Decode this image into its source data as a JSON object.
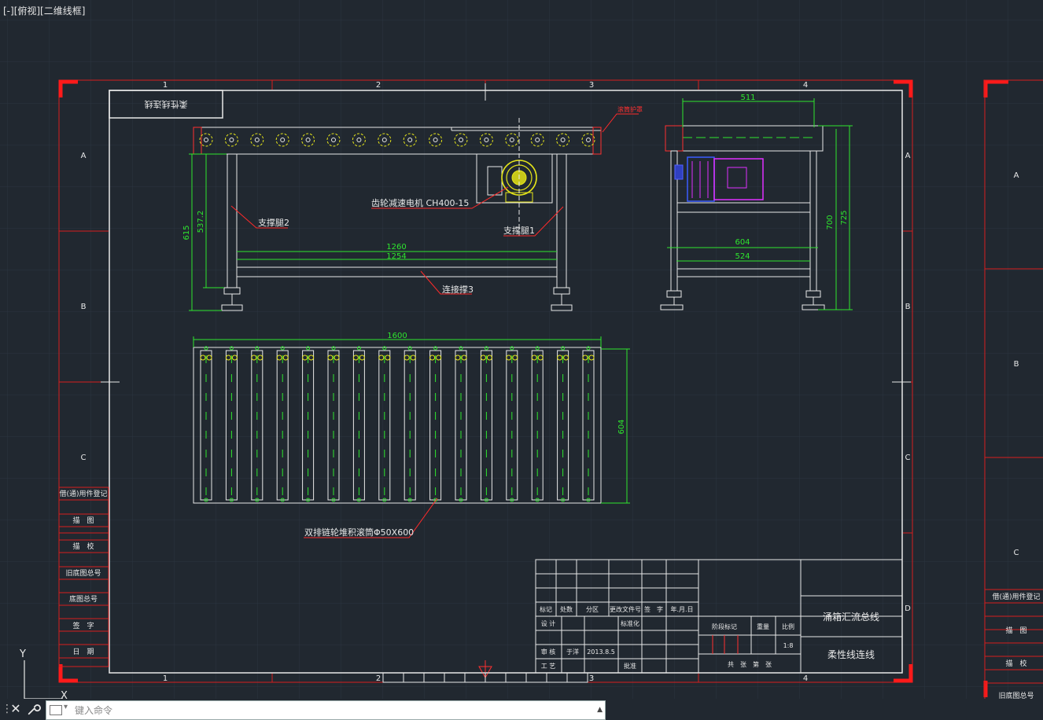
{
  "viewport": {
    "label": "[-][俯视][二维线框]"
  },
  "frame": {
    "columns": [
      "1",
      "2",
      "3",
      "4"
    ],
    "rows": [
      "A",
      "B",
      "C",
      "D"
    ],
    "right_sheet_rows": [
      "A",
      "B",
      "C"
    ]
  },
  "drawing": {
    "title_box": "柔性线连线",
    "front_view": {
      "nameplate": "滚筒护罩",
      "motor_label": "齿轮减速电机 CH400-15",
      "leg1_label": "支撑腿1",
      "leg2_label": "支撑腿2",
      "brace_label": "连接撑3",
      "dims": {
        "d1260": "1260",
        "d1254": "1254",
        "d615": "615",
        "d537": "537.2"
      }
    },
    "side_view": {
      "dims": {
        "d511": "511",
        "d604": "604",
        "d524": "524",
        "d700": "700",
        "d725": "725"
      }
    },
    "plan_view": {
      "roller_label": "双排链轮堆积滚筒Φ50X600",
      "dims": {
        "d1600": "1600",
        "d604": "604"
      }
    }
  },
  "left_strip": [
    "借(通)用件登记",
    "描　图",
    "描　校",
    "旧底图总号",
    "底图总号",
    "签　字",
    "日　期"
  ],
  "right_strip": [
    "借(通)用件登记",
    "描　图",
    "描　校",
    "旧底图总号"
  ],
  "title_block": {
    "headers": [
      "标记",
      "处数",
      "分区",
      "更改文件号",
      "签　字",
      "年.月.日"
    ],
    "design": "设 计",
    "standard": "标准化",
    "review": "审 核",
    "reviewer": "于洋",
    "date": "2013.8.5",
    "process": "工 艺",
    "approve": "批准",
    "stage_mark": "阶段标记",
    "weight": "重量",
    "scale_label": "比例",
    "scale_value": "1:8",
    "sheets": "共　张　第　张",
    "project": "涌箱汇流总线",
    "drawing_name": "柔性线连线"
  },
  "ucs": {
    "y": "Y",
    "x": "X"
  },
  "command": {
    "placeholder": "键入命令"
  },
  "colors": {
    "background": "#212830",
    "grid": "#2c3540",
    "frame": "#e8e8e8",
    "border_red": "#ff1a1a",
    "dimension": "#2ee62e",
    "leader": "#ff2a2a",
    "motor": "#e030ff",
    "roller": "#e5e51a"
  }
}
